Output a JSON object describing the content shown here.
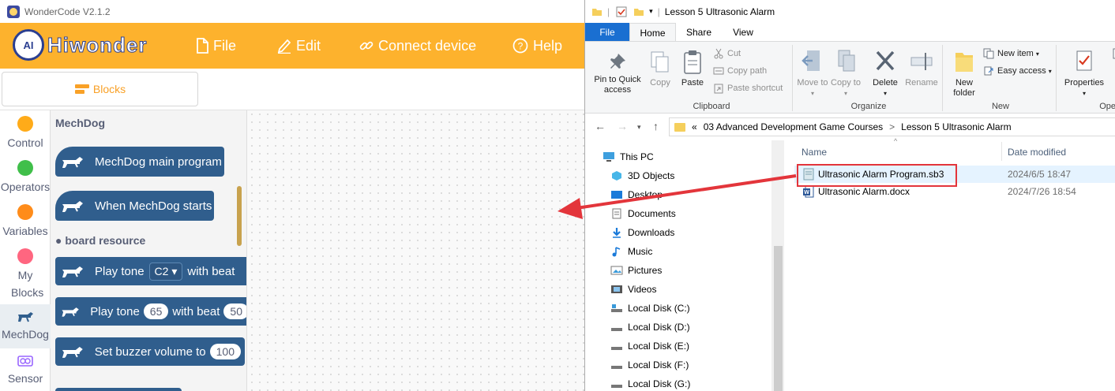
{
  "wondercode": {
    "window_title": "WonderCode V2.1.2",
    "logo_text": "Hiwonder",
    "logo_badge": "AI",
    "menu": {
      "file": "File",
      "edit": "Edit",
      "connect": "Connect device",
      "help": "Help"
    },
    "tabs": {
      "blocks": "Blocks"
    },
    "categories": [
      {
        "label": "Control",
        "color": "#ffab19"
      },
      {
        "label": "Operators",
        "color": "#40bf4a"
      },
      {
        "label": "Variables",
        "color": "#ff8c1a"
      },
      {
        "label": "My Blocks",
        "color": "#ff6680"
      },
      {
        "label": "MechDog",
        "color": ""
      },
      {
        "label": "Sensor",
        "color": ""
      }
    ],
    "flyout": {
      "heading": "MechDog",
      "subheading": "board resource",
      "blocks": {
        "main_program": "MechDog main program",
        "when_starts": "When MechDog starts",
        "play_tone_1_text": "Play tone",
        "play_tone_1_note": "C2",
        "play_tone_1_beat": "with beat",
        "play_tone_2_text": "Play tone",
        "play_tone_2_value": "65",
        "play_tone_2_beat": "with beat",
        "play_tone_2_beat_value": "50",
        "buzzer_text": "Set buzzer volume to",
        "buzzer_value": "100"
      },
      "block_color": "#305e8d"
    },
    "accent_color": "#fdb22d"
  },
  "explorer": {
    "window_title": "Lesson 5 Ultrasonic Alarm",
    "ribbon_tabs": [
      "File",
      "Home",
      "Share",
      "View"
    ],
    "ribbon": {
      "pin": "Pin to Quick access",
      "copy": "Copy",
      "paste": "Paste",
      "cut": "Cut",
      "copy_path": "Copy path",
      "paste_shortcut": "Paste shortcut",
      "move_to": "Move to",
      "copy_to": "Copy to",
      "delete": "Delete",
      "rename": "Rename",
      "new_folder": "New folder",
      "new_item": "New item",
      "easy_access": "Easy access",
      "properties": "Properties",
      "open_group": "Ope",
      "groups": {
        "clipboard": "Clipboard",
        "organize": "Organize",
        "new": "New"
      }
    },
    "address": {
      "prefix": "«",
      "parent": "03 Advanced Development Game Courses",
      "separator": ">",
      "current": "Lesson 5 Ultrasonic Alarm"
    },
    "nav_items": [
      "This PC",
      "3D Objects",
      "Desktop",
      "Documents",
      "Downloads",
      "Music",
      "Pictures",
      "Videos",
      "Local Disk (C:)",
      "Local Disk (D:)",
      "Local Disk (E:)",
      "Local Disk (F:)",
      "Local Disk (G:)"
    ],
    "columns": {
      "name": "Name",
      "date": "Date modified"
    },
    "files": [
      {
        "name": "Ultrasonic Alarm Program.sb3",
        "date": "2024/6/5 18:47",
        "type": "sb3"
      },
      {
        "name": "Ultrasonic Alarm.docx",
        "date": "2024/7/26 18:54",
        "type": "docx"
      }
    ]
  },
  "annotation": {
    "color": "#e3353b"
  }
}
